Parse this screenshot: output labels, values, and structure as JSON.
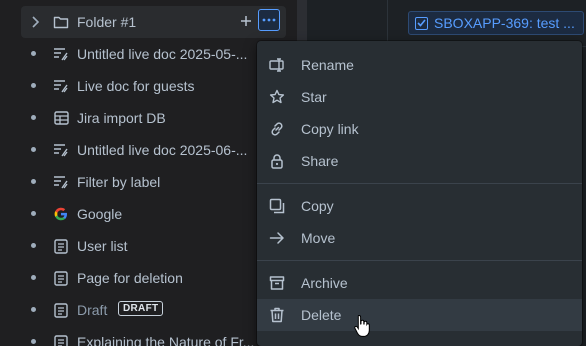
{
  "tree": {
    "folder": {
      "label": "Folder #1"
    },
    "items": [
      {
        "icon": "live-doc-icon",
        "label": "Untitled live doc 2025-05-..."
      },
      {
        "icon": "live-doc-icon",
        "label": "Live doc for guests"
      },
      {
        "icon": "database-icon",
        "label": "Jira import DB"
      },
      {
        "icon": "live-doc-icon",
        "label": "Untitled live doc 2025-06-..."
      },
      {
        "icon": "live-doc-icon",
        "label": "Filter by label"
      },
      {
        "icon": "google-icon",
        "label": "Google"
      },
      {
        "icon": "page-icon",
        "label": "User list"
      },
      {
        "icon": "page-icon",
        "label": "Page for deletion"
      },
      {
        "icon": "page-icon",
        "label": "Draft",
        "badge": "DRAFT"
      },
      {
        "icon": "page-icon",
        "label": "Explaining the Nature of Fr..."
      }
    ]
  },
  "right_panel": {
    "jira_issue": "SBOXAPP-369: test ..."
  },
  "menu": {
    "groups": [
      [
        {
          "icon": "rename-icon",
          "label": "Rename"
        },
        {
          "icon": "star-icon",
          "label": "Star"
        },
        {
          "icon": "link-icon",
          "label": "Copy link"
        },
        {
          "icon": "lock-icon",
          "label": "Share"
        }
      ],
      [
        {
          "icon": "copy-icon",
          "label": "Copy"
        },
        {
          "icon": "arrow-right-icon",
          "label": "Move"
        }
      ],
      [
        {
          "icon": "archive-icon",
          "label": "Archive"
        },
        {
          "icon": "trash-icon",
          "label": "Delete",
          "hovered": true
        }
      ]
    ]
  },
  "colors": {
    "accent": "#579dff",
    "menu_bg": "#282e33",
    "menu_hover": "#333b43",
    "text": "#b6c2cf"
  }
}
